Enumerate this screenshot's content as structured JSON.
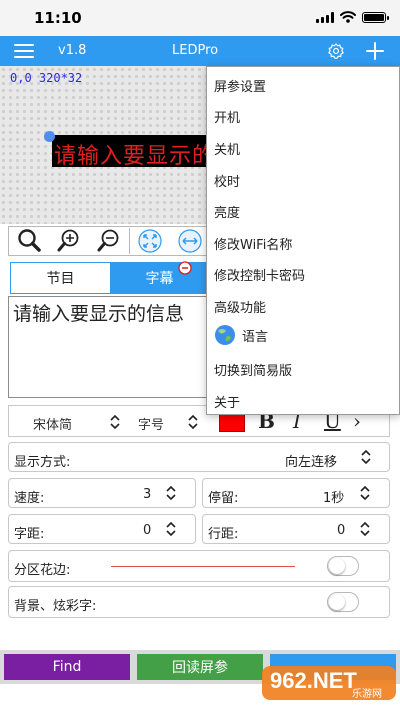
{
  "status_bar": {
    "time": "11:10",
    "signal_icon": "cellular-signal-icon",
    "wifi_icon": "wifi-icon",
    "battery_icon": "battery-icon",
    "battery_level": 1.0
  },
  "app_bar": {
    "menu_icon": "hamburger-menu-icon",
    "version": "v1.8",
    "title": "LEDPro",
    "settings_icon": "gear-icon",
    "add_icon": "plus-icon",
    "color": "#2f9bf0"
  },
  "preview": {
    "coord_text": "0,0 320*32",
    "led_text": "请输入要显示的信息",
    "led_color": "#e02020"
  },
  "toolbar": {
    "icons": [
      "zoom-fit-icon",
      "zoom-in-icon",
      "zoom-out-icon",
      "expand-icon",
      "horizontal-arrows-icon"
    ]
  },
  "tabs": [
    {
      "label": "节目",
      "active": false
    },
    {
      "label": "字幕",
      "active": true
    }
  ],
  "text_area": {
    "value": "请输入要显示的信息"
  },
  "font_row": {
    "font": "宋体简",
    "size_label": "字号",
    "color": "#ff0000",
    "bold": "B",
    "italic": "I",
    "underline": "U",
    "more": "›"
  },
  "display_mode": {
    "label": "显示方式:",
    "value": "向左连移"
  },
  "speed": {
    "label": "速度:",
    "value": "3"
  },
  "stay": {
    "label": "停留:",
    "value": "1秒"
  },
  "char_spacing": {
    "label": "字距:",
    "value": "0"
  },
  "line_spacing": {
    "label": "行距:",
    "value": "0"
  },
  "border": {
    "label": "分区花边:",
    "enabled": false
  },
  "background": {
    "label": "背景、炫彩字:",
    "enabled": false
  },
  "bottom": {
    "find_label": "Find",
    "find_color": "#7b1fa2",
    "readback_label": "回读屏参",
    "readback_color": "#43a047",
    "watermark": "962.NET",
    "watermark_sub": "乐游网"
  },
  "dropdown_menu": [
    {
      "label": "屏参设置"
    },
    {
      "label": "开机"
    },
    {
      "label": "关机"
    },
    {
      "label": "校时"
    },
    {
      "label": "亮度"
    },
    {
      "label": "修改WiFi名称"
    },
    {
      "label": "修改控制卡密码"
    },
    {
      "label": "高级功能"
    },
    {
      "label": "语言",
      "icon": "globe-icon"
    },
    {
      "label": "切换到简易版"
    },
    {
      "label": "关于"
    }
  ]
}
